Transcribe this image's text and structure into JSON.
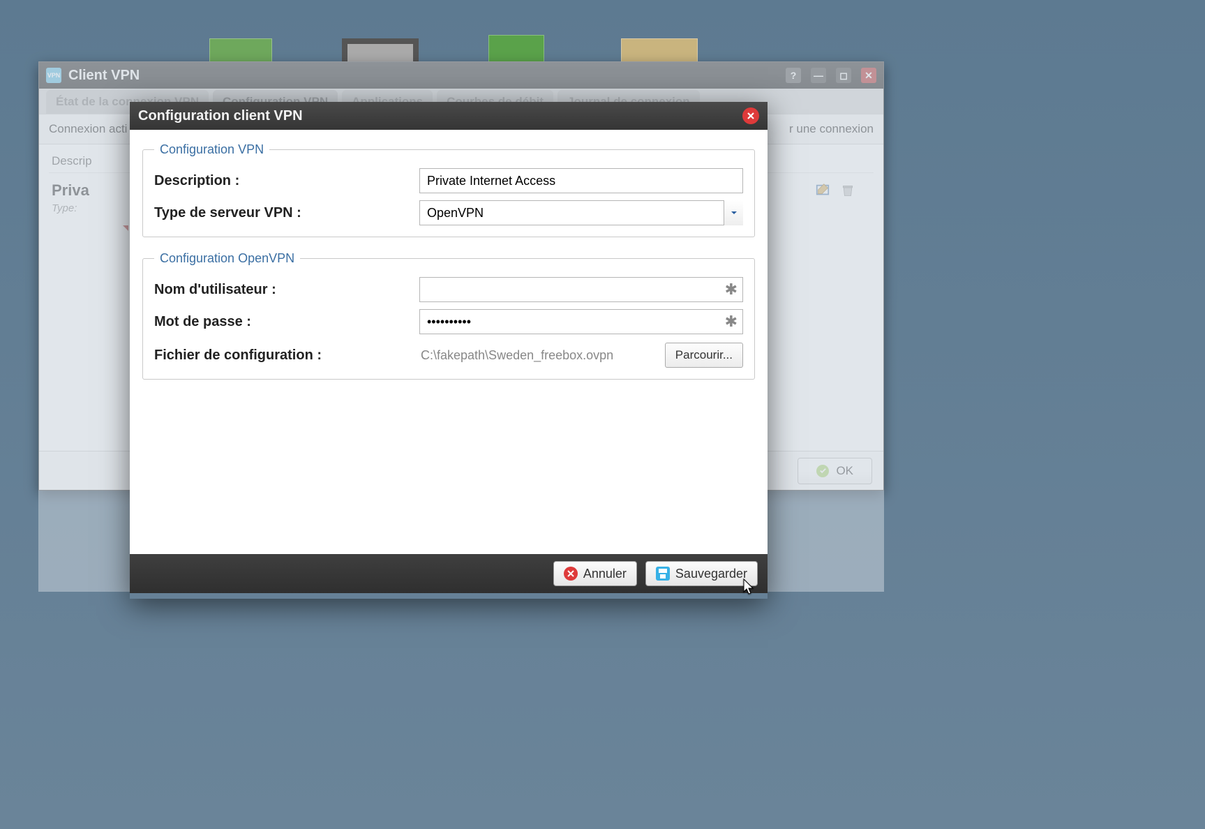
{
  "parent_window": {
    "title": "Client VPN",
    "app_icon_text": "VPN",
    "tabs": [
      {
        "label": "État de la connexion VPN"
      },
      {
        "label": "Configuration VPN"
      },
      {
        "label": "Applications"
      },
      {
        "label": "Courbes de débit"
      },
      {
        "label": "Journal de connexion"
      }
    ],
    "toolbar": {
      "left_text": "Connexion acti",
      "right_text": "r une connexion"
    },
    "columns": {
      "desc": "Descrip"
    },
    "item": {
      "title": "Priva",
      "subtitle_prefix": "Type: "
    },
    "ok_label": "OK"
  },
  "modal": {
    "title": "Configuration client VPN",
    "group_vpn": {
      "legend": "Configuration VPN",
      "description_label": "Description :",
      "description_value": "Private Internet Access",
      "type_label": "Type de serveur VPN :",
      "type_value": "OpenVPN"
    },
    "group_openvpn": {
      "legend": "Configuration OpenVPN",
      "username_label": "Nom d'utilisateur :",
      "username_value": "",
      "password_label": "Mot de passe :",
      "password_value": "••••••••••",
      "configfile_label": "Fichier de configuration :",
      "configfile_path": "C:\\fakepath\\Sweden_freebox.ovpn",
      "browse_label": "Parcourir..."
    },
    "buttons": {
      "cancel": "Annuler",
      "save": "Sauvegarder"
    }
  }
}
